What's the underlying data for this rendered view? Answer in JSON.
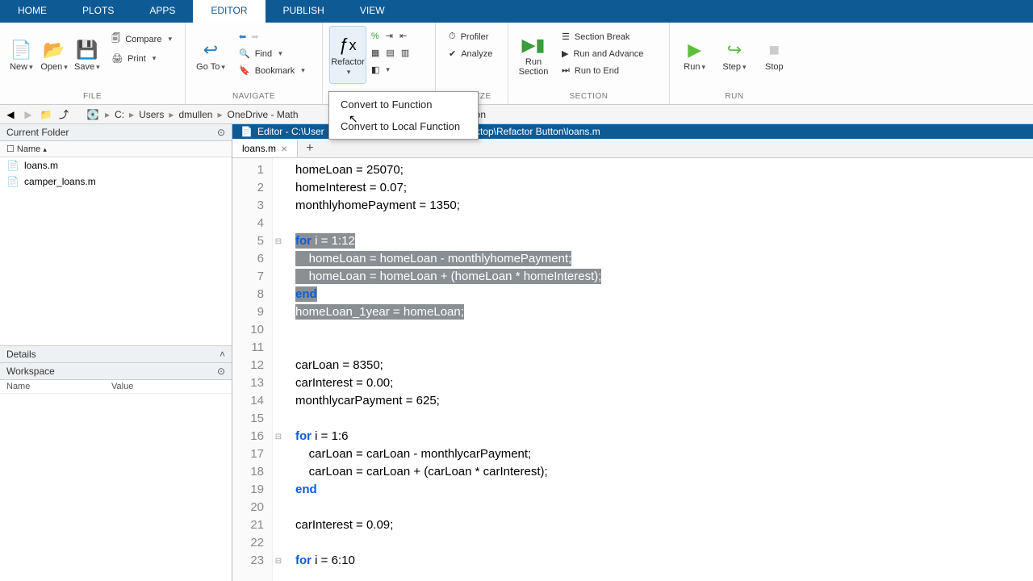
{
  "tabs": {
    "home": "HOME",
    "plots": "PLOTS",
    "apps": "APPS",
    "editor": "EDITOR",
    "publish": "PUBLISH",
    "view": "VIEW"
  },
  "ribbon": {
    "file": {
      "label": "FILE",
      "new": "New",
      "open": "Open",
      "save": "Save",
      "compare": "Compare",
      "print": "Print"
    },
    "navigate": {
      "label": "NAVIGATE",
      "goto": "Go To",
      "find": "Find",
      "bookmark": "Bookmark"
    },
    "code": {
      "refactor": "Refactor"
    },
    "analyze": {
      "label": "ANALYZE",
      "profiler": "Profiler",
      "analyze": "Analyze"
    },
    "section": {
      "label": "SECTION",
      "run": "Run\nSection",
      "break": "Section Break",
      "advance": "Run and Advance",
      "toend": "Run to End"
    },
    "run": {
      "label": "RUN",
      "run": "Run",
      "step": "Step",
      "stop": "Stop"
    }
  },
  "dropdown": {
    "item1": "Convert to Function",
    "item2": "Convert to Local Function"
  },
  "path": {
    "drive": "C:",
    "p1": "Users",
    "p2": "dmullen",
    "p3": "OneDrive - Math",
    "trail": "r Button"
  },
  "currentFolder": {
    "title": "Current Folder",
    "nameCol": "Name",
    "files": [
      "loans.m",
      "camper_loans.m"
    ]
  },
  "details": {
    "title": "Details"
  },
  "workspace": {
    "title": "Workspace",
    "nameCol": "Name",
    "valueCol": "Value"
  },
  "editor": {
    "titlePrefix": "Editor - C:\\User",
    "titleSuffix": "orks\\Desktop\\Refactor Button\\loans.m",
    "tabName": "loans.m",
    "lines": [
      {
        "n": 1,
        "text": "homeLoan = 25070;"
      },
      {
        "n": 2,
        "text": "homeInterest = 0.07;"
      },
      {
        "n": 3,
        "text": "monthlyhomePayment = 1350;"
      },
      {
        "n": 4,
        "text": ""
      },
      {
        "n": 5,
        "text": "for i = 1:12",
        "sel": true,
        "kw": "for",
        "fold": true
      },
      {
        "n": 6,
        "text": "    homeLoan = homeLoan - monthlyhomePayment;",
        "sel": true
      },
      {
        "n": 7,
        "text": "    homeLoan = homeLoan + (homeLoan * homeInterest);",
        "sel": true
      },
      {
        "n": 8,
        "text": "end",
        "sel": true,
        "kw": "end"
      },
      {
        "n": 9,
        "text": "homeLoan_1year = homeLoan;",
        "sel": true
      },
      {
        "n": 10,
        "text": ""
      },
      {
        "n": 11,
        "text": ""
      },
      {
        "n": 12,
        "text": "carLoan = 8350;"
      },
      {
        "n": 13,
        "text": "carInterest = 0.00;"
      },
      {
        "n": 14,
        "text": "monthlycarPayment = 625;"
      },
      {
        "n": 15,
        "text": ""
      },
      {
        "n": 16,
        "text": "for i = 1:6",
        "kw": "for",
        "fold": true
      },
      {
        "n": 17,
        "text": "    carLoan = carLoan - monthlycarPayment;"
      },
      {
        "n": 18,
        "text": "    carLoan = carLoan + (carLoan * carInterest);"
      },
      {
        "n": 19,
        "text": "end",
        "kw": "end"
      },
      {
        "n": 20,
        "text": ""
      },
      {
        "n": 21,
        "text": "carInterest = 0.09;"
      },
      {
        "n": 22,
        "text": ""
      },
      {
        "n": 23,
        "text": "for i = 6:10",
        "kw": "for",
        "fold": true
      }
    ]
  }
}
